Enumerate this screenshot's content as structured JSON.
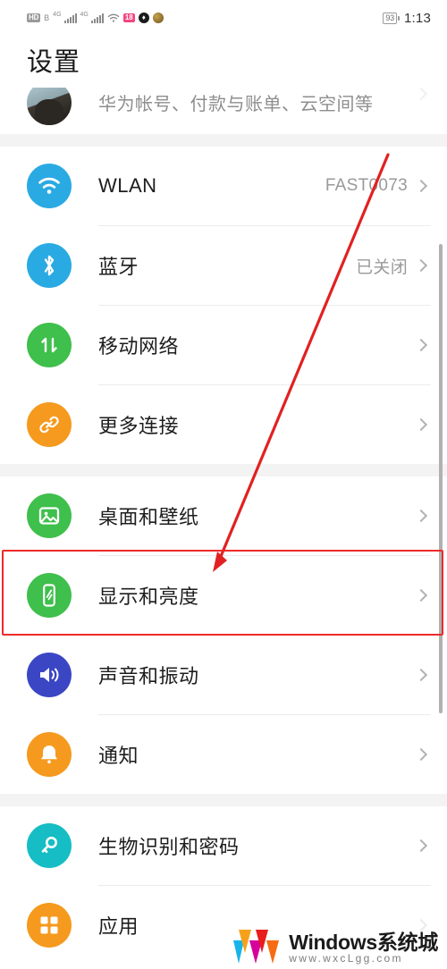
{
  "statusbar": {
    "hd_badge": "HD",
    "sim_badge": "B",
    "net1": "4G",
    "net2": "4G",
    "wifi_icon": "wifi-icon",
    "pink_badge": "18",
    "battery_level": "93",
    "time": "1:13"
  },
  "page_title": "设置",
  "sections": [
    {
      "rows": [
        {
          "id": "account",
          "icon": "avatar",
          "label": "华为帐号、付款与账单、云空间等",
          "value": "",
          "partial": true
        }
      ]
    },
    {
      "rows": [
        {
          "id": "wlan",
          "icon": "wifi-icon",
          "icon_color": "#2aaae2",
          "label": "WLAN",
          "value": "FAST0073"
        },
        {
          "id": "bluetooth",
          "icon": "bluetooth-icon",
          "icon_color": "#2aaae2",
          "label": "蓝牙",
          "value": "已关闭"
        },
        {
          "id": "mobile-network",
          "icon": "data-transfer-icon",
          "icon_color": "#3fbf4c",
          "label": "移动网络",
          "value": ""
        },
        {
          "id": "more-connections",
          "icon": "link-icon",
          "icon_color": "#f59a1e",
          "label": "更多连接",
          "value": ""
        }
      ]
    },
    {
      "rows": [
        {
          "id": "home-screen-wallpaper",
          "icon": "image-icon",
          "icon_color": "#3fbf4c",
          "label": "桌面和壁纸",
          "value": ""
        },
        {
          "id": "display-brightness",
          "icon": "phone-brightness-icon",
          "icon_color": "#3fbf4c",
          "label": "显示和亮度",
          "value": "",
          "highlighted": true
        },
        {
          "id": "sound-vibration",
          "icon": "speaker-icon",
          "icon_color": "#3b46c4",
          "label": "声音和振动",
          "value": ""
        },
        {
          "id": "notifications",
          "icon": "bell-icon",
          "icon_color": "#f59a1e",
          "label": "通知",
          "value": ""
        }
      ]
    },
    {
      "rows": [
        {
          "id": "biometrics-password",
          "icon": "key-icon",
          "icon_color": "#16bdc4",
          "label": "生物识别和密码",
          "value": ""
        },
        {
          "id": "apps",
          "icon": "grid-icon",
          "icon_color": "#f59a1e",
          "label": "应用",
          "value": ""
        }
      ]
    }
  ],
  "annotation": {
    "arrow_color": "#e12121",
    "highlight_color": "#ef2a2a",
    "highlight_target": "显示和亮度"
  },
  "watermark": {
    "name": "Windows系统城",
    "url": "www.wxcLgg.com"
  }
}
